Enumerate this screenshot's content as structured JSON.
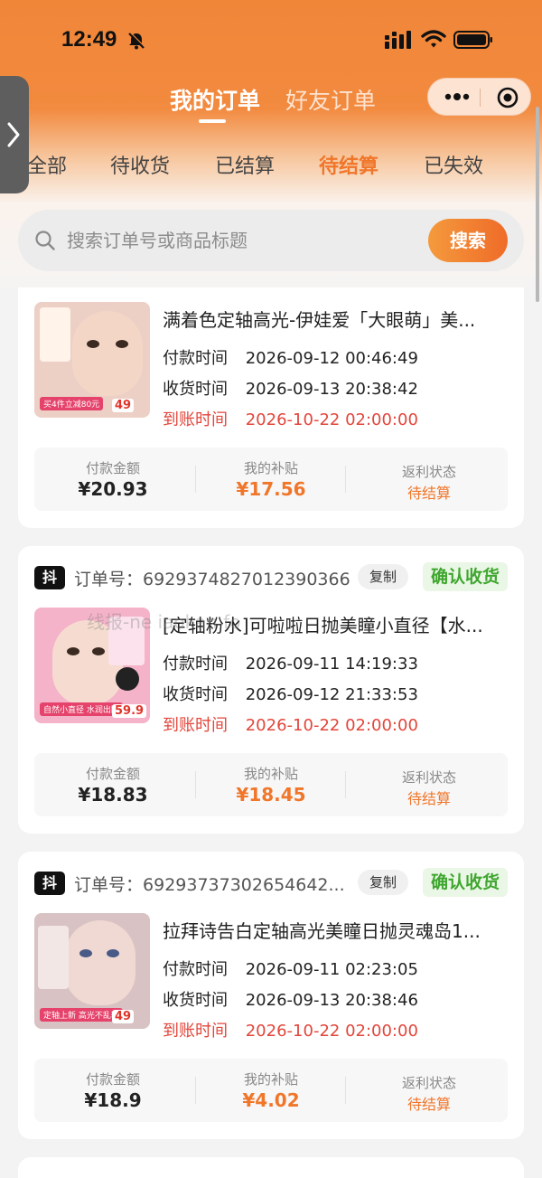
{
  "status_bar": {
    "time": "12:49"
  },
  "header": {
    "tabs": [
      {
        "label": "我的订单"
      },
      {
        "label": "好友订单"
      }
    ]
  },
  "status_tabs": [
    "全部",
    "待收货",
    "已结算",
    "待结算",
    "已失效"
  ],
  "active_status_tab": "待结算",
  "search": {
    "placeholder": "搜索订单号或商品标题",
    "button_label": "搜索"
  },
  "labels": {
    "pay_time": "付款时间",
    "receive_time": "收货时间",
    "arrival_time": "到账时间",
    "pay_amount": "付款金额",
    "my_subsidy": "我的补贴",
    "rebate_status": "返利状态",
    "order_no": "订单号：",
    "copy": "复制",
    "confirm_receipt": "确认收货",
    "douyin_badge": "抖"
  },
  "watermark": "线报-ne   iaokan   fo",
  "orders": [
    {
      "order_no": "",
      "title": "满着色定轴高光-伊娃爱「大眼萌」美...",
      "pay_time": "2026-09-12 00:46:49",
      "receive_time": "2026-09-13 20:38:42",
      "arrival_time": "2026-10-22 02:00:00",
      "pay_amount": "¥20.93",
      "subsidy": "¥17.56",
      "rebate_status": "待结算",
      "thumb_price": "49",
      "thumb_tag": "买4件立减80元",
      "thumb_bg": "#e9c9c0"
    },
    {
      "order_no": "6929374827012390366",
      "title": "[定轴粉水]可啦啦日抛美瞳小直径【水...",
      "pay_time": "2026-09-11 14:19:33",
      "receive_time": "2026-09-12 21:33:53",
      "arrival_time": "2026-10-22 02:00:00",
      "pay_amount": "¥18.83",
      "subsidy": "¥18.45",
      "rebate_status": "待结算",
      "thumb_price": "59.9",
      "thumb_tag": "自然小直径 水润出圈",
      "thumb_bg": "#f2a9c4"
    },
    {
      "order_no": "69293737302654642...",
      "title": "拉拜诗告白定轴高光美瞳日抛灵魂岛1...",
      "pay_time": "2026-09-11 02:23:05",
      "receive_time": "2026-09-13 20:38:46",
      "arrival_time": "2026-10-22 02:00:00",
      "pay_amount": "¥18.9",
      "subsidy": "¥4.02",
      "rebate_status": "待结算",
      "thumb_price": "49",
      "thumb_tag": "定轴上新 高光不乱转",
      "thumb_bg": "#d9c4c4"
    }
  ],
  "colors": {
    "accent": "#f0762a",
    "header_top": "#f08638",
    "confirm_green": "#3fa62f",
    "arrival_red": "#e2463b"
  }
}
